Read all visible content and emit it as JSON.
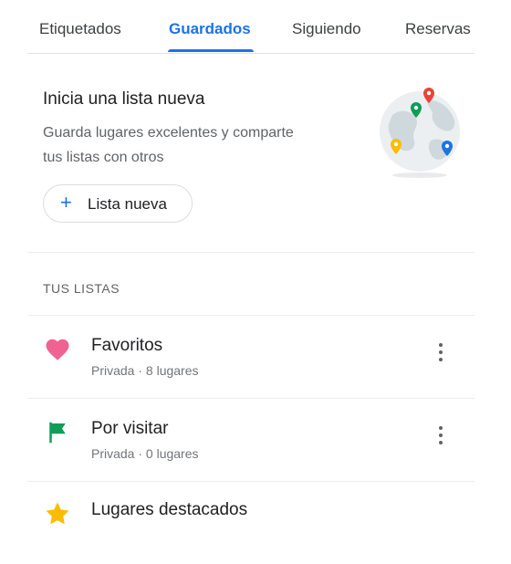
{
  "tabs": [
    {
      "label": "Etiquetados",
      "active": false
    },
    {
      "label": "Guardados",
      "active": true
    },
    {
      "label": "Siguiendo",
      "active": false
    },
    {
      "label": "Reservas",
      "active": false
    }
  ],
  "promo": {
    "title": "Inicia una lista nueva",
    "description": "Guarda lugares excelentes y comparte tus listas con otros",
    "button_label": "Lista nueva",
    "illustration": "globe-with-pins"
  },
  "section_title": "TUS LISTAS",
  "lists": [
    {
      "name": "Favoritos",
      "meta": "Privada · 8 lugares",
      "icon": "heart-icon",
      "icon_color": "#f06292"
    },
    {
      "name": "Por visitar",
      "meta": "Privada · 0 lugares",
      "icon": "flag-icon",
      "icon_color": "#0f9d58"
    },
    {
      "name": "Lugares destacados",
      "meta": "",
      "icon": "star-icon",
      "icon_color": "#fbbc04"
    }
  ],
  "colors": {
    "accent": "#1a73e8",
    "text": "#202124",
    "secondary": "#5f6368"
  }
}
